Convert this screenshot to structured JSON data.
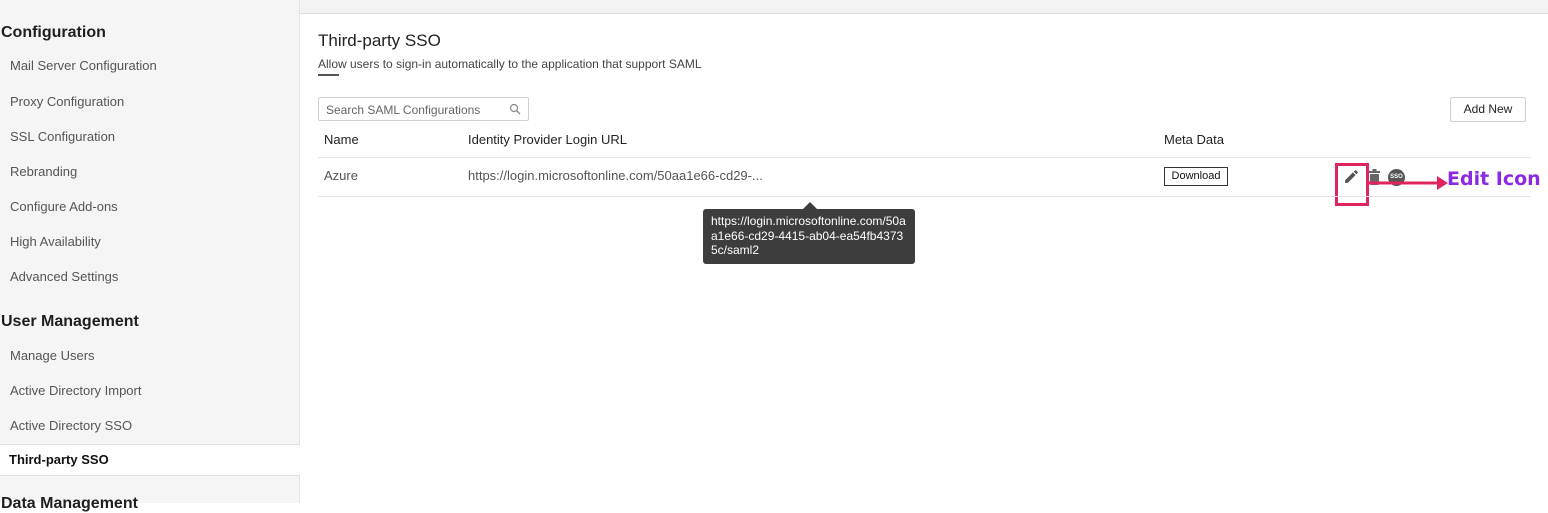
{
  "sidebar": {
    "sections": [
      {
        "title": "Configuration",
        "items": [
          "Mail Server Configuration",
          "Proxy Configuration",
          "SSL Configuration",
          "Rebranding",
          "Configure Add-ons",
          "High Availability",
          "Advanced Settings"
        ]
      },
      {
        "title": "User Management",
        "items": [
          "Manage Users",
          "Active Directory Import",
          "Active Directory SSO",
          "Third-party SSO"
        ]
      },
      {
        "title": "Data Management"
      }
    ],
    "active_item": "Third-party SSO"
  },
  "page": {
    "title": "Third-party SSO",
    "description": "Allow users to sign-in automatically to the application that support SAML"
  },
  "search": {
    "placeholder": "Search SAML Configurations",
    "value": ""
  },
  "toolbar": {
    "add_new_label": "Add New"
  },
  "table": {
    "columns": [
      "Name",
      "Identity Provider Login URL",
      "Meta Data"
    ],
    "rows": [
      {
        "name": "Azure",
        "url_truncated": "https://login.microsoftonline.com/50aa1e66-cd29-...",
        "metadata_button": "Download",
        "actions": [
          "edit-icon",
          "delete-icon",
          "sso-icon"
        ],
        "sso_badge": "SSO"
      }
    ]
  },
  "tooltip": {
    "text": "https://login.microsoftonline.com/50aa1e66-cd29-4415-ab04-ea54fb43735c/saml2"
  },
  "annotation": {
    "label": "Edit Icon",
    "color": "#8a2be2",
    "highlight_color": "#e0245e"
  }
}
